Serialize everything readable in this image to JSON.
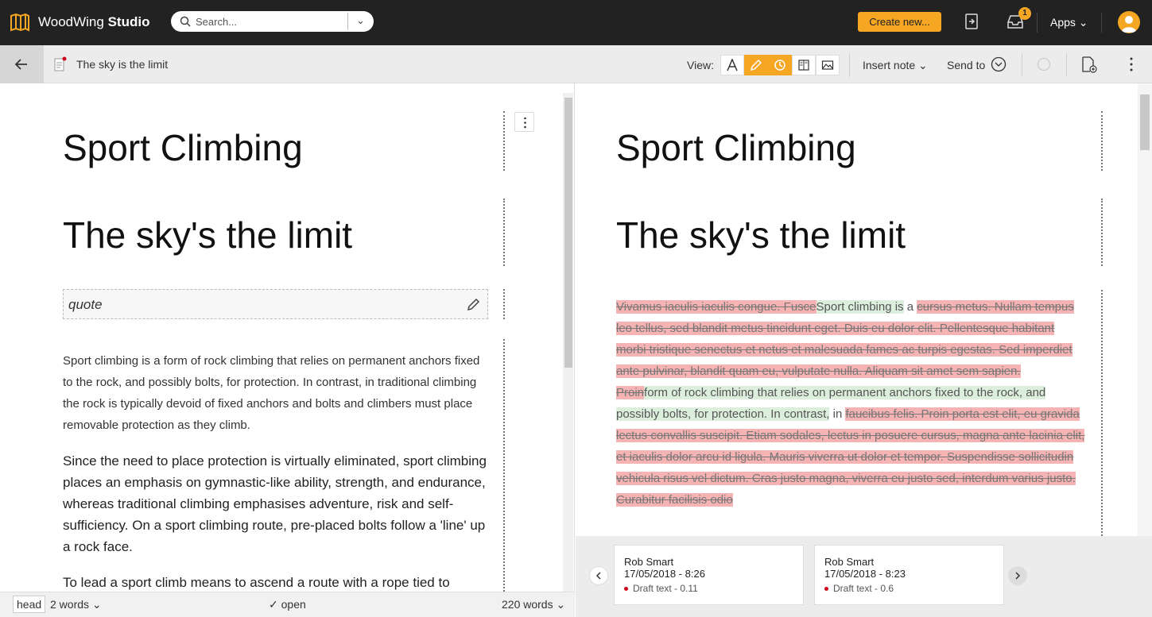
{
  "topbar": {
    "brand_normal": "WoodWing",
    "brand_bold": "Studio",
    "search_placeholder": "Search...",
    "create_label": "Create new...",
    "inbox_badge": "1",
    "apps_label": "Apps"
  },
  "toolbar": {
    "doc_title": "The sky is the limit",
    "view_label": "View:",
    "insert_note_label": "Insert note",
    "send_to_label": "Send to"
  },
  "left": {
    "heading": "Sport Climbing",
    "subheading": "The sky's the limit",
    "quote_placeholder": "quote",
    "intro": "Sport climbing is a form of rock climbing that relies on permanent anchors fixed to the rock, and possibly bolts, for protection. In contrast, in traditional climbing the rock is typically devoid of fixed anchors and bolts and climbers must place removable protection as they climb.",
    "body1": "Since the need to place protection is virtually eliminated, sport climbing places an emphasis on gymnastic-like ability, strength, and endurance, whereas traditional climbing emphasises adventure, risk and self-sufficiency. On a sport climbing route, pre-placed bolts follow a 'line' up a rock face.",
    "body2": "To lead a sport climb means to ascend a route with a rope tied to"
  },
  "status": {
    "component": "head",
    "component_words": "2 words",
    "state": "open",
    "total_words": "220 words"
  },
  "right": {
    "heading": "Sport Climbing",
    "subheading": "The sky's the limit",
    "diff": {
      "d1": "Vivamus iaculis iaculis congue. Fusce",
      "i1": "Sport climbing is",
      "t1": " a ",
      "d2": "cursus metus. Nullam tempus leo tellus, sed blandit metus tincidunt eget. Duis eu dolor elit. Pellentesque habitant morbi tristique senectus et netus et malesuada fames ac turpis egestas. Sed imperdiet ante pulvinar, blandit quam eu, vulputate nulla. Aliquam sit amet sem sapien.",
      "d3": "Proin",
      "i2": "form of rock climbing that relies on permanent anchors fixed to the rock, and possibly bolts, for protection. In contrast,",
      "t2": " in ",
      "d4": "faucibus felis. Proin porta est elit, eu gravida lectus convallis suscipit. Etiam sodales, lectus in posuere cursus, magna ante lacinia elit, et iaculis dolor arcu id ligula. Mauris viverra ut dolor et tempor. Suspendisse sollicitudin vehicula risus vel dictum. Cras justo magna, viverra eu justo sed, interdum varius justo. Curabitur facilisis odio"
    }
  },
  "versions": [
    {
      "author": "Rob Smart",
      "date": "17/05/2018 - 8:26",
      "status": "Draft text - 0.11"
    },
    {
      "author": "Rob Smart",
      "date": "17/05/2018 - 8:23",
      "status": "Draft text - 0.6"
    }
  ],
  "colors": {
    "accent": "#f5a623",
    "topbar": "#222222",
    "deleted": "#f6b3b3",
    "inserted": "#dcefdc"
  }
}
